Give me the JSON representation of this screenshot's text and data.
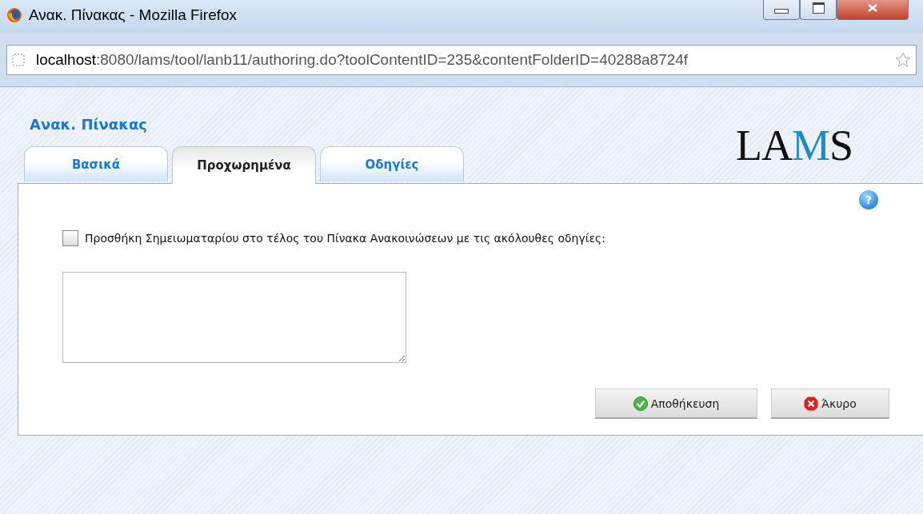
{
  "window": {
    "title": "Ανακ. Πίνακας - Mozilla Firefox"
  },
  "address_bar": {
    "host": "localhost",
    "path": ":8080/lams/tool/lanb11/authoring.do?toolContentID=235&contentFolderID=40288a8724f"
  },
  "page": {
    "heading": "Ανακ. Πίνακας",
    "logo": "LAMS",
    "help": "?",
    "tabs": [
      {
        "label": "Βασικά",
        "selected": false
      },
      {
        "label": "Προχωρημένα",
        "selected": true
      },
      {
        "label": "Οδηγίες",
        "selected": false
      }
    ],
    "option": {
      "label": "Προσθήκη Σημειωματαρίου στο τέλος του Πίνακα Ανακοινώσεων με τις ακόλουθες οδηγίες:",
      "checked": false
    },
    "buttons": [
      {
        "label": "Αποθήκευση",
        "kind": "save"
      },
      {
        "label": "Άκυρο",
        "kind": "cancel"
      }
    ]
  }
}
